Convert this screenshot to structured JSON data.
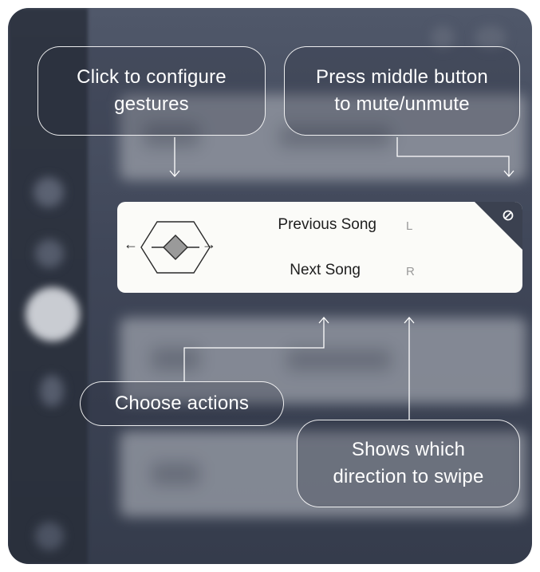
{
  "callouts": {
    "configure": "Click to configure gestures",
    "mute_line1": "Press middle button",
    "mute_line2": "to mute/unmute",
    "choose": "Choose actions",
    "direction_line1": "Shows which",
    "direction_line2": "direction to swipe"
  },
  "gesture_card": {
    "left_arrow": "←",
    "right_arrow": "→",
    "actions": [
      {
        "label": "Previous Song",
        "key": "L"
      },
      {
        "label": "Next Song",
        "key": "R"
      }
    ],
    "disable_icon": "ban-icon"
  },
  "colors": {
    "background": "#3f4658",
    "card": "#fbfbf8",
    "callout_border": "#ffffff"
  }
}
